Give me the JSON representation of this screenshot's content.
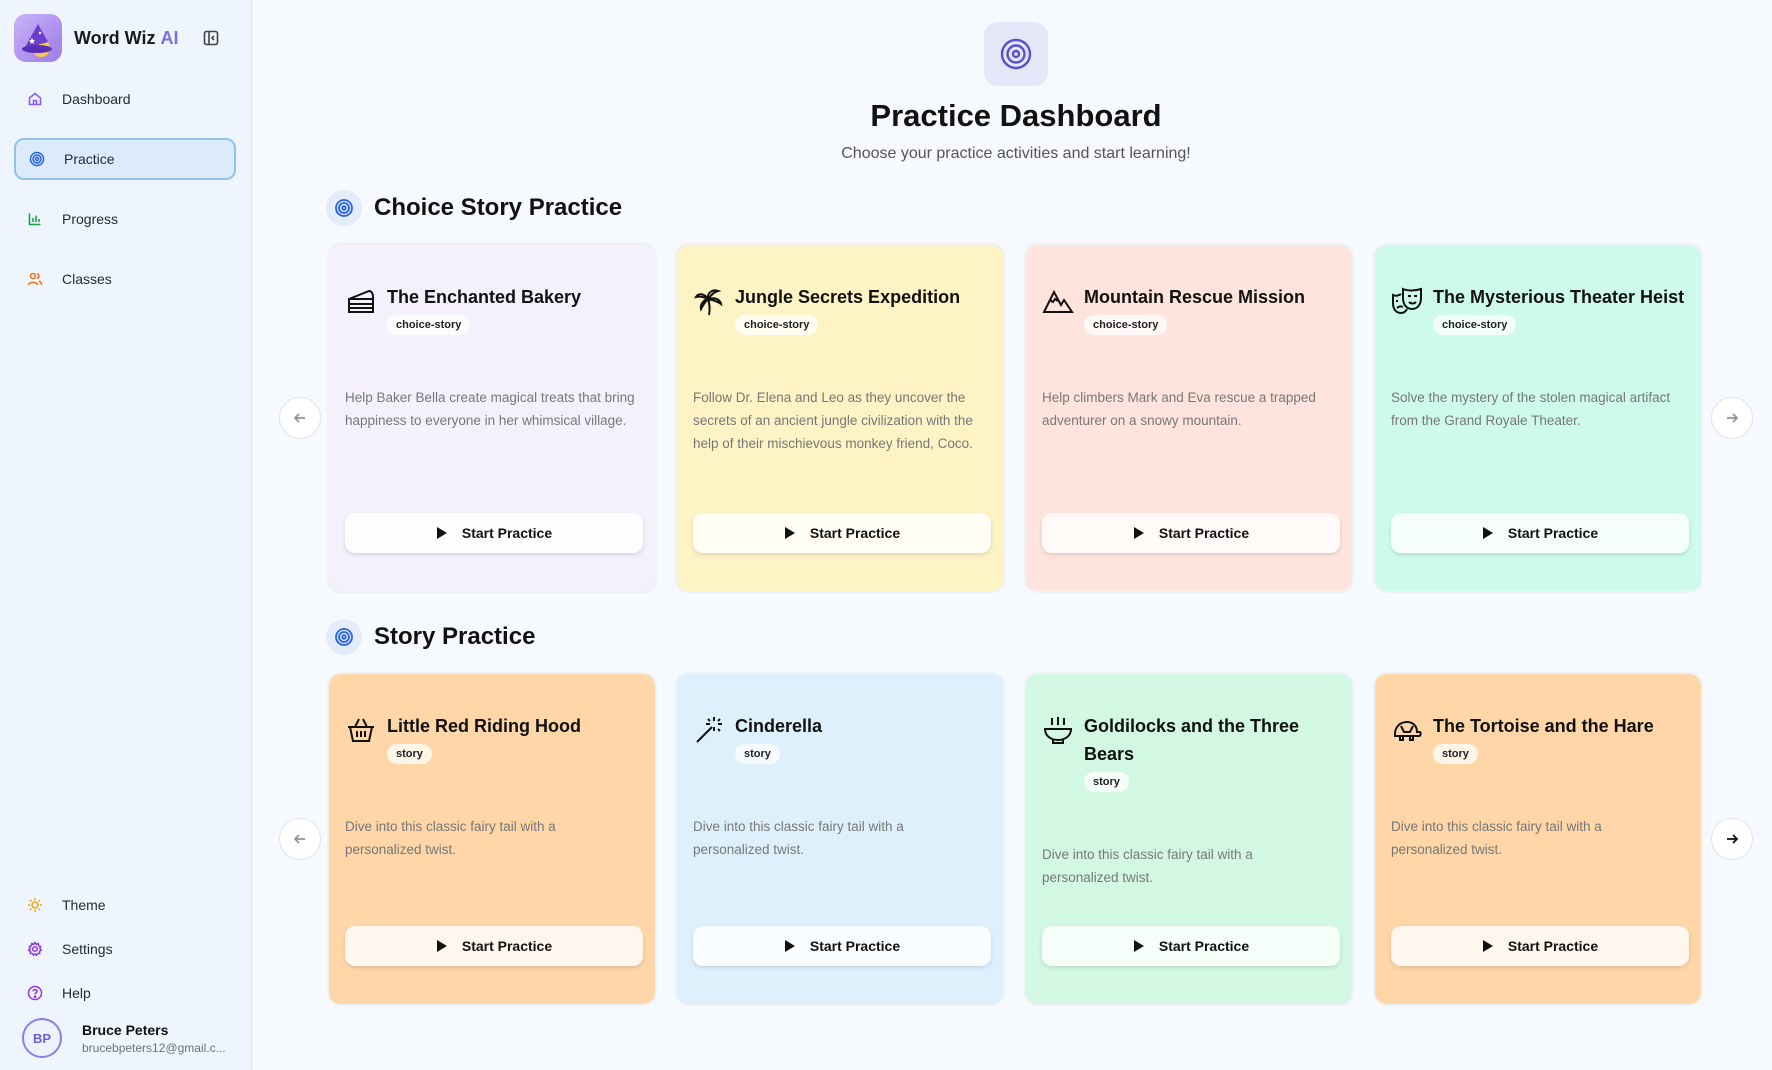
{
  "sidebar": {
    "brand": "Word Wiz",
    "brand_ai": "AI",
    "nav": [
      {
        "label": "Dashboard",
        "icon": "home-icon"
      },
      {
        "label": "Practice",
        "icon": "target-icon"
      },
      {
        "label": "Progress",
        "icon": "bar-chart-icon"
      },
      {
        "label": "Classes",
        "icon": "users-icon"
      }
    ],
    "bottom": [
      {
        "label": "Theme",
        "icon": "sun-icon"
      },
      {
        "label": "Settings",
        "icon": "gear-icon"
      },
      {
        "label": "Help",
        "icon": "help-icon"
      }
    ],
    "user": {
      "initials": "BP",
      "name": "Bruce Peters",
      "email": "brucebpeters12@gmail.c..."
    }
  },
  "main": {
    "title": "Practice Dashboard",
    "subtitle": "Choose your practice activities and start learning!",
    "sections": [
      {
        "title": "Choice Story Practice",
        "cards": [
          {
            "title": "The Enchanted Bakery",
            "tag": "choice-story",
            "desc": "Help Baker Bella create magical treats that bring happiness to everyone in her whimsical village.",
            "button": "Start Practice",
            "icon": "cake-icon",
            "bg": "#f4f1fd"
          },
          {
            "title": "Jungle Secrets Expedition",
            "tag": "choice-story",
            "desc": "Follow Dr. Elena and Leo as they uncover the secrets of an ancient jungle civilization with the help of their mischievous monkey friend, Coco.",
            "button": "Start Practice",
            "icon": "palm-tree-icon",
            "bg": "#fef3c5"
          },
          {
            "title": "Mountain Rescue Mission",
            "tag": "choice-story",
            "desc": "Help climbers Mark and Eva rescue a trapped adventurer on a snowy mountain.",
            "button": "Start Practice",
            "icon": "mountain-icon",
            "bg": "#fee4dc"
          },
          {
            "title": "The Mysterious Theater Heist",
            "tag": "choice-story",
            "desc": "Solve the mystery of the stolen magical artifact from the Grand Royale Theater.",
            "button": "Start Practice",
            "icon": "theater-masks-icon",
            "bg": "#cdfaeb"
          }
        ]
      },
      {
        "title": "Story Practice",
        "cards": [
          {
            "title": "Little Red Riding Hood",
            "tag": "story",
            "desc": "Dive into this classic fairy tail with a personalized twist.",
            "button": "Start Practice",
            "icon": "basket-icon",
            "bg": "#fed6a8"
          },
          {
            "title": "Cinderella",
            "tag": "story",
            "desc": "Dive into this classic fairy tail with a personalized twist.",
            "button": "Start Practice",
            "icon": "magic-wand-icon",
            "bg": "#dff0fd"
          },
          {
            "title": "Goldilocks and the Three Bears",
            "tag": "story",
            "desc": "Dive into this classic fairy tail with a personalized twist.",
            "button": "Start Practice",
            "icon": "bowl-icon",
            "bg": "#d2f8e4"
          },
          {
            "title": "The Tortoise and the Hare",
            "tag": "story",
            "desc": "Dive into this classic fairy tail with a personalized twist.",
            "button": "Start Practice",
            "icon": "turtle-icon",
            "bg": "#fed6a8"
          }
        ]
      }
    ]
  },
  "colors": {
    "accent": "#7c6ee6",
    "active_nav_bg": "#dcebfa",
    "active_nav_border": "#8ec2ef"
  }
}
